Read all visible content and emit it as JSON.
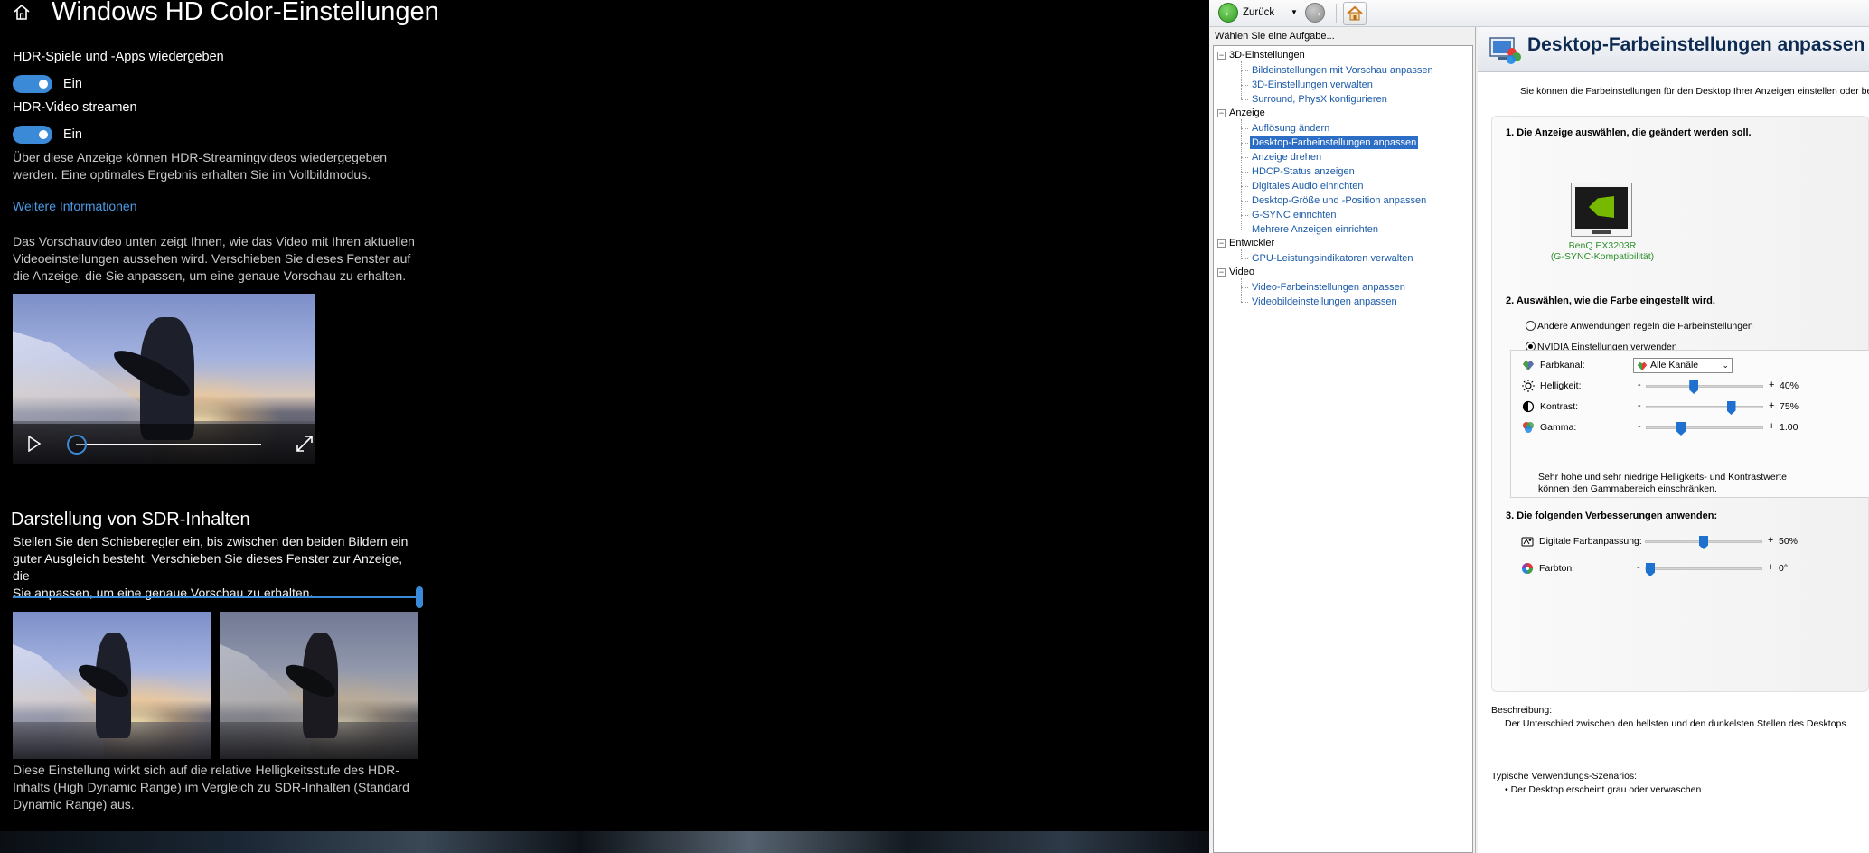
{
  "windows": {
    "title": "Windows HD Color-Einstellungen",
    "hdr_games_label": "HDR-Spiele und -Apps wiedergeben",
    "hdr_games_state": "Ein",
    "hdr_video_label": "HDR-Video streamen",
    "hdr_video_state": "Ein",
    "hdr_video_desc_1": "Über diese Anzeige können HDR-Streamingvideos wiedergegeben",
    "hdr_video_desc_2": "werden. Eine optimales Ergebnis erhalten Sie im Vollbildmodus.",
    "more_info_link": "Weitere Informationen",
    "preview_desc_1": "Das Vorschauvideo unten zeigt Ihnen, wie das Video mit Ihren aktuellen",
    "preview_desc_2": "Videoeinstellungen aussehen wird. Verschieben Sie dieses Fenster auf",
    "preview_desc_3": "die Anzeige, die Sie anpassen, um eine genaue Vorschau zu erhalten.",
    "sdr_heading": "Darstellung von SDR-Inhalten",
    "sdr_desc_1": "Stellen Sie den Schieberegler ein, bis zwischen den beiden Bildern ein",
    "sdr_desc_2": "guter Ausgleich besteht. Verschieben Sie dieses Fenster zur Anzeige, die",
    "sdr_desc_3": "Sie anpassen, um eine genaue Vorschau zu erhalten.",
    "sdr_note_1": "Diese Einstellung wirkt sich auf die relative Helligkeitsstufe des HDR-",
    "sdr_note_2": "Inhalts (High Dynamic Range) im Vergleich zu SDR-Inhalten (Standard",
    "sdr_note_3": "Dynamic Range) aus.",
    "sdr_slider_fraction": 1.0,
    "accent_color": "#3a8ad7"
  },
  "nvidia": {
    "toolbar": {
      "back_label": "Zurück"
    },
    "task_heading": "Wählen Sie eine Aufgabe...",
    "tree": [
      {
        "label": "3D-Einstellungen",
        "children": [
          "Bildeinstellungen mit Vorschau anpassen",
          "3D-Einstellungen verwalten",
          "Surround, PhysX konfigurieren"
        ]
      },
      {
        "label": "Anzeige",
        "children": [
          "Auflösung ändern",
          "Desktop-Farbeinstellungen anpassen",
          "Anzeige drehen",
          "HDCP-Status anzeigen",
          "Digitales Audio einrichten",
          "Desktop-Größe und -Position anpassen",
          "G-SYNC einrichten",
          "Mehrere Anzeigen einrichten"
        ]
      },
      {
        "label": "Entwickler",
        "children": [
          "GPU-Leistungsindikatoren verwalten"
        ]
      },
      {
        "label": "Video",
        "children": [
          "Video-Farbeinstellungen anpassen",
          "Videobildeinstellungen anpassen"
        ]
      }
    ],
    "selected_item": "Desktop-Farbeinstellungen anpassen",
    "page_title": "Desktop-Farbeinstellungen anpassen",
    "intro": "Sie können die Farbeinstellungen für den Desktop Ihrer Anzeigen einstellen oder bei Ve",
    "step1": "1. Die Anzeige auswählen, die geändert werden soll.",
    "monitor_name": "BenQ EX3203R",
    "monitor_sub": "(G-SYNC-Kompatibilität)",
    "step2": "2. Auswählen, wie die Farbe eingestellt wird.",
    "radio_other": "Andere Anwendungen regeln die Farbeinstellungen",
    "radio_nvidia": "NVIDIA Einstellungen verwenden",
    "channel_label": "Farbkanal:",
    "channel_value": "Alle Kanäle",
    "minus": "-",
    "plus": "+",
    "brightness": {
      "label": "Helligkeit:",
      "value": "40%",
      "fraction": 0.4
    },
    "contrast": {
      "label": "Kontrast:",
      "value": "75%",
      "fraction": 0.75
    },
    "gamma": {
      "label": "Gamma:",
      "value": "1.00",
      "fraction": 0.28
    },
    "range_note_1": "Sehr hohe und sehr niedrige Helligkeits- und Kontrastwerte",
    "range_note_2": "können den Gammabereich einschränken.",
    "step3": "3. Die folgenden Verbesserungen anwenden:",
    "vibrance": {
      "label": "Digitale Farbanpassung:",
      "value": "50%",
      "fraction": 0.5
    },
    "hue": {
      "label": "Farbton:",
      "value": "0°",
      "fraction": 0.0
    },
    "desc_heading": "Beschreibung:",
    "desc_text": "Der Unterschied zwischen den hellsten und den dunkelsten Stellen des Desktops.",
    "usage_heading": "Typische Verwendungs-Szenarios:",
    "usage_text": "• Der Desktop erscheint grau oder verwaschen",
    "title_color": "#0d2a53",
    "link_color": "#1a5aa8",
    "selection_color": "#2c6dc5"
  }
}
